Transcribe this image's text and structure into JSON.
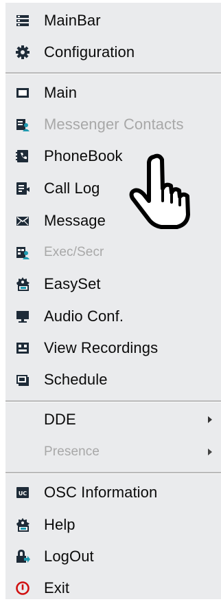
{
  "menu": {
    "group1": [
      {
        "label": "MainBar",
        "icon": "list-icon",
        "enabled": true
      },
      {
        "label": "Configuration",
        "icon": "gear-icon",
        "enabled": true
      }
    ],
    "group2": [
      {
        "label": "Main",
        "icon": "window-icon",
        "enabled": true
      },
      {
        "label": "Messenger Contacts",
        "icon": "contacts-icon",
        "enabled": false
      },
      {
        "label": "PhoneBook",
        "icon": "phonebook-icon",
        "enabled": true
      },
      {
        "label": "Call Log",
        "icon": "call-log-icon",
        "enabled": true
      },
      {
        "label": "Message",
        "icon": "envelope-icon",
        "enabled": true
      },
      {
        "label": "Exec/Secr",
        "icon": "exec-secr-icon",
        "enabled": false
      },
      {
        "label": "EasySet",
        "icon": "easyset-icon",
        "enabled": true
      },
      {
        "label": "Audio Conf.",
        "icon": "monitor-icon",
        "enabled": true
      },
      {
        "label": "View Recordings",
        "icon": "recordings-icon",
        "enabled": true
      },
      {
        "label": "Schedule",
        "icon": "schedule-icon",
        "enabled": true
      }
    ],
    "group3": [
      {
        "label": "DDE",
        "enabled": true,
        "submenu": true
      },
      {
        "label": "Presence",
        "enabled": false,
        "submenu": true
      }
    ],
    "group4": [
      {
        "label": "OSC Information",
        "icon": "osc-icon",
        "badge": "UC",
        "enabled": true
      },
      {
        "label": "Help",
        "icon": "help-icon",
        "enabled": true
      },
      {
        "label": "LogOut",
        "icon": "logout-icon",
        "enabled": true
      },
      {
        "label": "Exit",
        "icon": "exit-icon",
        "enabled": true
      }
    ]
  },
  "colors": {
    "menu_background": "#eaebed",
    "text": "#0b0b0b",
    "disabled_text": "#a8a8a8",
    "icon_dark": "#1e2b38",
    "exit_red": "#d01010"
  },
  "cursor": {
    "icon": "hand-pointer-icon"
  }
}
